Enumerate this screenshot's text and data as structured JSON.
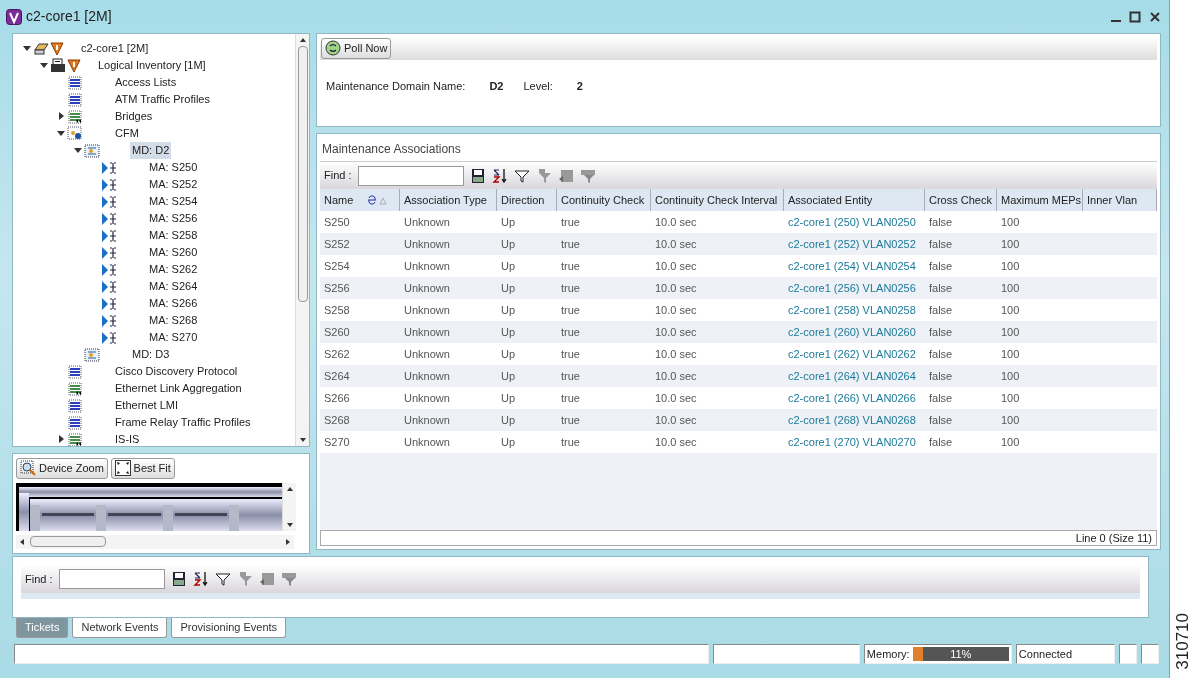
{
  "window": {
    "title": "c2-core1 [2M]"
  },
  "tree": [
    {
      "label": "c2-core1 [2M]",
      "kind": "device",
      "alarm": true,
      "expanded": true,
      "selected": false,
      "children": [
        {
          "label": "Logical Inventory [1M]",
          "kind": "inventory",
          "alarm": true,
          "expanded": true,
          "selected": false,
          "children": [
            {
              "label": "Access Lists",
              "kind": "table",
              "alarm": false,
              "selected": false
            },
            {
              "label": "ATM Traffic Profiles",
              "kind": "table",
              "alarm": false,
              "selected": false
            },
            {
              "label": "Bridges",
              "kind": "table-link",
              "alarm": false,
              "expanded": false,
              "selected": false
            },
            {
              "label": "CFM",
              "kind": "cfm",
              "expanded": true,
              "selected": false,
              "children": [
                {
                  "label": "MD: D2",
                  "kind": "domain",
                  "expanded": true,
                  "selected": true,
                  "children": [
                    {
                      "label": "MA: S250",
                      "kind": "association",
                      "alarm": false,
                      "selected": false
                    },
                    {
                      "label": "MA: S252",
                      "kind": "association",
                      "alarm": false,
                      "selected": false
                    },
                    {
                      "label": "MA: S254",
                      "kind": "association",
                      "alarm": false,
                      "selected": false
                    },
                    {
                      "label": "MA: S256",
                      "kind": "association",
                      "alarm": false,
                      "selected": false
                    },
                    {
                      "label": "MA: S258",
                      "kind": "association",
                      "alarm": false,
                      "selected": false
                    },
                    {
                      "label": "MA: S260",
                      "kind": "association",
                      "alarm": false,
                      "selected": false
                    },
                    {
                      "label": "MA: S262",
                      "kind": "association",
                      "alarm": false,
                      "selected": false
                    },
                    {
                      "label": "MA: S264",
                      "kind": "association",
                      "alarm": false,
                      "selected": false
                    },
                    {
                      "label": "MA: S266",
                      "kind": "association",
                      "alarm": false,
                      "selected": false
                    },
                    {
                      "label": "MA: S268",
                      "kind": "association",
                      "alarm": false,
                      "selected": false
                    },
                    {
                      "label": "MA: S270",
                      "kind": "association",
                      "alarm": false,
                      "selected": false
                    }
                  ]
                },
                {
                  "label": "MD: D3",
                  "kind": "domain",
                  "alarm": false,
                  "selected": false
                }
              ]
            },
            {
              "label": "Cisco Discovery Protocol",
              "kind": "table",
              "alarm": false,
              "selected": false
            },
            {
              "label": "Ethernet Link Aggregation",
              "kind": "table-link",
              "alarm": false,
              "selected": false
            },
            {
              "label": "Ethernet LMI",
              "kind": "table",
              "alarm": false,
              "selected": false
            },
            {
              "label": "Frame Relay Traffic Profiles",
              "kind": "table",
              "alarm": false,
              "selected": false
            },
            {
              "label": "IS-IS",
              "kind": "table-link",
              "alarm": false,
              "expanded": false,
              "selected": false
            }
          ]
        }
      ]
    }
  ],
  "device_view": {
    "buttons": [
      {
        "label": "Device Zoom",
        "kind": "zoom"
      },
      {
        "label": "Best Fit",
        "kind": "fit"
      }
    ]
  },
  "details": {
    "poll_button": "Poll Now",
    "fields": [
      {
        "label": "Maintenance Domain Name:",
        "value": "D2"
      },
      {
        "label": "Level:",
        "value": "2"
      }
    ]
  },
  "associations": {
    "title": "Maintenance Associations",
    "find_label": "Find :",
    "columns": [
      {
        "label": "Name",
        "sorted": true,
        "link": false
      },
      {
        "label": "Association Type",
        "link": false
      },
      {
        "label": "Direction",
        "link": false
      },
      {
        "label": "Continuity Check",
        "link": false
      },
      {
        "label": "Continuity Check Interval",
        "link": false
      },
      {
        "label": "Associated Entity",
        "link": true
      },
      {
        "label": "Cross Check",
        "link": false
      },
      {
        "label": "Maximum MEPs",
        "link": false
      },
      {
        "label": "Inner Vlan"
      }
    ],
    "rows": [
      [
        "S250",
        "Unknown",
        "Up",
        "true",
        "10.0 sec",
        "c2-core1 (250) VLAN0250",
        "false",
        "100"
      ],
      [
        "S252",
        "Unknown",
        "Up",
        "true",
        "10.0 sec",
        "c2-core1 (252) VLAN0252",
        "false",
        "100"
      ],
      [
        "S254",
        "Unknown",
        "Up",
        "true",
        "10.0 sec",
        "c2-core1 (254) VLAN0254",
        "false",
        "100"
      ],
      [
        "S256",
        "Unknown",
        "Up",
        "true",
        "10.0 sec",
        "c2-core1 (256) VLAN0256",
        "false",
        "100"
      ],
      [
        "S258",
        "Unknown",
        "Up",
        "true",
        "10.0 sec",
        "c2-core1 (258) VLAN0258",
        "false",
        "100"
      ],
      [
        "S260",
        "Unknown",
        "Up",
        "true",
        "10.0 sec",
        "c2-core1 (260) VLAN0260",
        "false",
        "100"
      ],
      [
        "S262",
        "Unknown",
        "Up",
        "true",
        "10.0 sec",
        "c2-core1 (262) VLAN0262",
        "false",
        "100"
      ],
      [
        "S264",
        "Unknown",
        "Up",
        "true",
        "10.0 sec",
        "c2-core1 (264) VLAN0264",
        "false",
        "100"
      ],
      [
        "S266",
        "Unknown",
        "Up",
        "true",
        "10.0 sec",
        "c2-core1 (266) VLAN0266",
        "false",
        "100"
      ],
      [
        "S268",
        "Unknown",
        "Up",
        "true",
        "10.0 sec",
        "c2-core1 (268) VLAN0268",
        "false",
        "100"
      ],
      [
        "S270",
        "Unknown",
        "Up",
        "true",
        "10.0 sec",
        "c2-core1 (270) VLAN0270",
        "false",
        "100"
      ]
    ],
    "footer": "Line 0 (Size 11)"
  },
  "events": {
    "find_label": "Find :",
    "tabs": [
      {
        "label": "Tickets",
        "selected": true
      },
      {
        "label": "Network Events",
        "selected": false
      },
      {
        "label": "Provisioning Events",
        "selected": false
      }
    ]
  },
  "status_bar": {
    "memory_label": "Memory:",
    "memory": {
      "level": 0.11,
      "reading": "11%"
    },
    "connection": "Connected"
  },
  "figure_number": "310710"
}
